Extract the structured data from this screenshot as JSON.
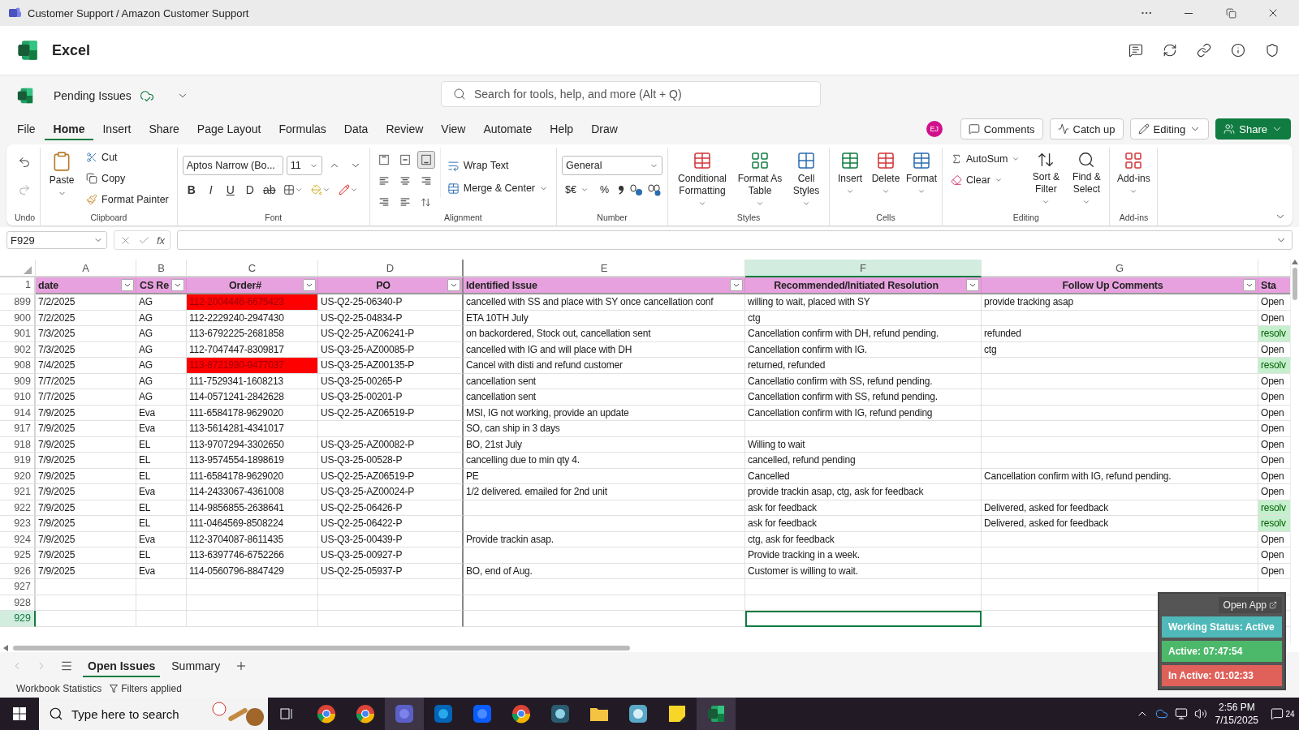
{
  "window": {
    "title": "Customer Support / Amazon Customer Support"
  },
  "app": {
    "name": "Excel"
  },
  "document": {
    "name": "Pending Issues",
    "search_placeholder": "Search for tools, help, and more (Alt + Q)"
  },
  "menu_tabs": [
    {
      "label": "File",
      "selected": false
    },
    {
      "label": "Home",
      "selected": true
    },
    {
      "label": "Insert",
      "selected": false
    },
    {
      "label": "Share",
      "selected": false
    },
    {
      "label": "Page Layout",
      "selected": false
    },
    {
      "label": "Formulas",
      "selected": false
    },
    {
      "label": "Data",
      "selected": false
    },
    {
      "label": "Review",
      "selected": false
    },
    {
      "label": "View",
      "selected": false
    },
    {
      "label": "Automate",
      "selected": false
    },
    {
      "label": "Help",
      "selected": false
    },
    {
      "label": "Draw",
      "selected": false
    }
  ],
  "user": {
    "initials": "EJ"
  },
  "actions": {
    "comments": "Comments",
    "catch_up": "Catch up",
    "editing": "Editing",
    "share": "Share"
  },
  "ribbon": {
    "undo": {
      "label": "Undo"
    },
    "clipboard": {
      "paste": "Paste",
      "cut": "Cut",
      "copy": "Copy",
      "format_painter": "Format Painter",
      "label": "Clipboard"
    },
    "font": {
      "name": "Aptos Narrow (Bo...",
      "size": "11",
      "styles": [
        "B",
        "I",
        "U",
        "D"
      ],
      "strike": "ab",
      "label": "Font"
    },
    "alignment": {
      "vertical": [
        {
          "selected": false
        },
        {
          "selected": false
        },
        {
          "selected": true
        }
      ],
      "wrap": "Wrap Text",
      "merge": "Merge & Center",
      "label": "Alignment"
    },
    "number": {
      "format": "General",
      "currency": "$€",
      "percent": "%",
      "label": "Number"
    },
    "styles": {
      "buttons": [
        "Conditional Formatting",
        "Format As Table",
        "Cell Styles"
      ],
      "label": "Styles"
    },
    "cells": {
      "buttons": [
        "Insert",
        "Delete",
        "Format"
      ],
      "label": "Cells"
    },
    "editing": {
      "autosum": "AutoSum",
      "clear": "Clear",
      "buttons": [
        "Sort & Filter",
        "Find & Select"
      ],
      "label": "Editing"
    },
    "addins": {
      "button": "Add-ins",
      "label": "Add-ins"
    }
  },
  "formula_bar": {
    "name_box": "F929",
    "fx": "fx"
  },
  "sheet": {
    "columns": [
      {
        "letter": "A",
        "selected": false
      },
      {
        "letter": "B",
        "selected": false
      },
      {
        "letter": "C",
        "selected": false
      },
      {
        "letter": "D",
        "selected": false
      },
      {
        "letter": "E",
        "selected": false
      },
      {
        "letter": "F",
        "selected": true
      },
      {
        "letter": "G",
        "selected": false
      }
    ],
    "header_row": {
      "number": "1",
      "cells": [
        {
          "label": "date",
          "filter": true
        },
        {
          "label": "CS Re",
          "filter": true
        },
        {
          "label": "Order#",
          "filter": true
        },
        {
          "label": "PO",
          "filter": true
        },
        {
          "label": "Identified Issue",
          "filter": true
        },
        {
          "label": "Recommended/Initiated Resolution",
          "filter": true
        },
        {
          "label": "Follow Up Comments",
          "filter": true
        },
        {
          "label": "Sta",
          "filter": false
        }
      ]
    },
    "rows": [
      {
        "number": "899",
        "selected": false,
        "order_flagged": true,
        "resolved": false,
        "date": "7/2/2025",
        "rep": "AG",
        "order": "112-2004446-6675423",
        "po": "US-Q2-25-06340-P",
        "issue": "cancelled with SS and place with SY once cancellation conf",
        "resolution": "willing to wait, placed with SY",
        "follow_up": "provide tracking asap",
        "status": "Open"
      },
      {
        "number": "900",
        "selected": false,
        "order_flagged": false,
        "resolved": false,
        "date": "7/2/2025",
        "rep": "AG",
        "order": "112-2229240-2947430",
        "po": "US-Q2-25-04834-P",
        "issue": "ETA 10TH July",
        "resolution": "ctg",
        "status": "Open"
      },
      {
        "number": "901",
        "selected": false,
        "order_flagged": false,
        "resolved": true,
        "date": "7/3/2025",
        "rep": "AG",
        "order": "113-6792225-2681858",
        "po": "US-Q2-25-AZ06241-P",
        "issue": "on backordered, Stock out, cancellation sent",
        "resolution": "Cancellation confirm with DH, refund pending.",
        "follow_up": "refunded",
        "status": "resolv"
      },
      {
        "number": "902",
        "selected": false,
        "order_flagged": false,
        "resolved": false,
        "date": "7/3/2025",
        "rep": "AG",
        "order": "112-7047447-8309817",
        "po": "US-Q3-25-AZ00085-P",
        "issue": "cancelled with IG and will place with DH",
        "resolution": "Cancellation confirm with IG.",
        "follow_up": "ctg",
        "status": "Open"
      },
      {
        "number": "908",
        "selected": false,
        "order_flagged": true,
        "resolved": true,
        "date": "7/4/2025",
        "rep": "AG",
        "order": "113-8721930-9477037",
        "po": "US-Q3-25-AZ00135-P",
        "issue": "Cancel with disti and refund customer",
        "resolution": "returned, refunded",
        "status": "resolv"
      },
      {
        "number": "909",
        "selected": false,
        "order_flagged": false,
        "resolved": false,
        "date": "7/7/2025",
        "rep": "AG",
        "order": "111-7529341-1608213",
        "po": "US-Q3-25-00265-P",
        "issue": "cancellation sent",
        "resolution": "Cancellatio confirm with SS, refund pending.",
        "status": "Open"
      },
      {
        "number": "910",
        "selected": false,
        "order_flagged": false,
        "resolved": false,
        "date": "7/7/2025",
        "rep": "AG",
        "order": "114-0571241-2842628",
        "po": "US-Q3-25-00201-P",
        "issue": "cancellation sent",
        "resolution": "Cancellation confirm with SS, refund pending.",
        "status": "Open"
      },
      {
        "number": "914",
        "selected": false,
        "order_flagged": false,
        "resolved": false,
        "date": "7/9/2025",
        "rep": "Eva",
        "order": "111-6584178-9629020",
        "po": "US-Q2-25-AZ06519-P",
        "issue": "MSI, IG not working, provide an update",
        "resolution": "Cancellation confirm with IG, refund pending",
        "status": "Open"
      },
      {
        "number": "917",
        "selected": false,
        "order_flagged": false,
        "resolved": false,
        "date": "7/9/2025",
        "rep": "Eva",
        "order": "113-5614281-4341017",
        "issue": "SO, can ship in 3 days",
        "status": "Open"
      },
      {
        "number": "918",
        "selected": false,
        "order_flagged": false,
        "resolved": false,
        "date": "7/9/2025",
        "rep": "EL",
        "order": "113-9707294-3302650",
        "po": "US-Q3-25-AZ00082-P",
        "issue": "BO, 21st July",
        "resolution": "Willing to wait",
        "status": "Open"
      },
      {
        "number": "919",
        "selected": false,
        "order_flagged": false,
        "resolved": false,
        "date": "7/9/2025",
        "rep": "EL",
        "order": "113-9574554-1898619",
        "po": "US-Q3-25-00528-P",
        "issue": "cancelling due to min qty 4.",
        "resolution": "cancelled, refund pending",
        "status": "Open"
      },
      {
        "number": "920",
        "selected": false,
        "order_flagged": false,
        "resolved": false,
        "date": "7/9/2025",
        "rep": "EL",
        "order": "111-6584178-9629020",
        "po": "US-Q2-25-AZ06519-P",
        "issue": "PE",
        "resolution": "Cancelled",
        "follow_up": "Cancellation confirm with IG, refund pending.",
        "status": "Open"
      },
      {
        "number": "921",
        "selected": false,
        "order_flagged": false,
        "resolved": false,
        "date": "7/9/2025",
        "rep": "Eva",
        "order": "114-2433067-4361008",
        "po": "US-Q3-25-AZ00024-P",
        "issue": "1/2 delivered. emailed for 2nd unit",
        "resolution": "provide trackin asap, ctg, ask for feedback",
        "status": "Open"
      },
      {
        "number": "922",
        "selected": false,
        "order_flagged": false,
        "resolved": true,
        "date": "7/9/2025",
        "rep": "EL",
        "order": "114-9856855-2638641",
        "po": "US-Q2-25-06426-P",
        "resolution": "ask for feedback",
        "follow_up": "Delivered, asked for feedback",
        "status": "resolv"
      },
      {
        "number": "923",
        "selected": false,
        "order_flagged": false,
        "resolved": true,
        "date": "7/9/2025",
        "rep": "EL",
        "order": "111-0464569-8508224",
        "po": "US-Q2-25-06422-P",
        "resolution": "ask for feedback",
        "follow_up": "Delivered, asked for feedback",
        "status": "resolv"
      },
      {
        "number": "924",
        "selected": false,
        "order_flagged": false,
        "resolved": false,
        "date": "7/9/2025",
        "rep": "Eva",
        "order": "112-3704087-8611435",
        "po": "US-Q3-25-00439-P",
        "issue": "Provide trackin asap.",
        "resolution": "ctg, ask for feedback",
        "status": "Open"
      },
      {
        "number": "925",
        "selected": false,
        "order_flagged": false,
        "resolved": false,
        "date": "7/9/2025",
        "rep": "EL",
        "order": "113-6397746-6752266",
        "po": "US-Q3-25-00927-P",
        "resolution": "Provide tracking in a week.",
        "status": "Open"
      },
      {
        "number": "926",
        "selected": false,
        "order_flagged": false,
        "resolved": false,
        "date": "7/9/2025",
        "rep": "Eva",
        "order": "114-0560796-8847429",
        "po": "US-Q2-25-05937-P",
        "issue": "BO, end of Aug.",
        "resolution": "Customer is willing to wait.",
        "status": "Open"
      },
      {
        "number": "927",
        "selected": false
      },
      {
        "number": "928",
        "selected": false
      },
      {
        "number": "929",
        "selected": true
      }
    ]
  },
  "sheet_tabs": [
    {
      "label": "Open Issues",
      "selected": true
    },
    {
      "label": "Summary",
      "selected": false
    }
  ],
  "status_bar": {
    "statistics": "Workbook Statistics",
    "filters": "Filters applied"
  },
  "tracker": {
    "open_app": "Open App",
    "working_status": "Working Status: Active",
    "active": "Active: 07:47:54",
    "inactive": "In Active: 01:02:33"
  },
  "taskbar": {
    "search_placeholder": "Type here to search",
    "time": "2:56 PM",
    "date": "7/15/2025",
    "notifications": "24"
  }
}
